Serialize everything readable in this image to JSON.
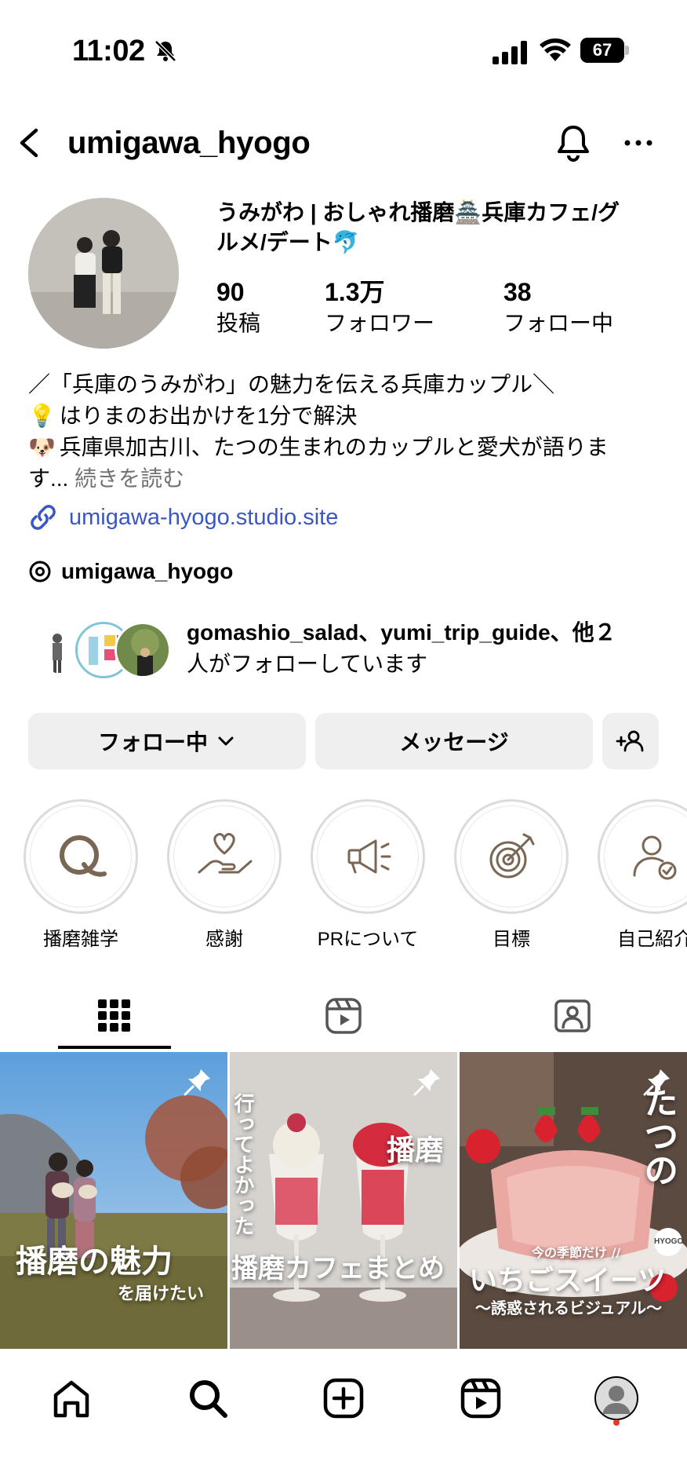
{
  "status_bar": {
    "time": "11:02",
    "battery": "67"
  },
  "header": {
    "username": "umigawa_hyogo"
  },
  "profile": {
    "display_name_line1": "うみがわ | おしゃれ播磨🏯兵庫カフェ/グ",
    "display_name_line2": "ルメ/デート🐬",
    "stats": [
      {
        "value": "90",
        "label": "投稿"
      },
      {
        "value": "1.3万",
        "label": "フォロワー"
      },
      {
        "value": "38",
        "label": "フォロー中"
      }
    ],
    "bio": {
      "line1": "／「兵庫のうみがわ」の魅力を伝える兵庫カップル＼",
      "line2_emoji": "💡",
      "line2": "はりまのお出かけを1分で解決",
      "line3_emoji": "🐶",
      "line3": "兵庫県加古川、たつの生まれのカップルと愛犬が語りま",
      "line4": "す...",
      "more": "続きを読む"
    },
    "website": "umigawa-hyogo.studio.site",
    "threads_handle": "umigawa_hyogo",
    "mutuals_line1": "gomashio_salad、yumi_trip_guide、他２",
    "mutuals_line2": "人がフォローしています"
  },
  "buttons": {
    "following": "フォロー中",
    "message": "メッセージ"
  },
  "highlights": [
    {
      "label": "播磨雑学",
      "icon": "q-letter-icon"
    },
    {
      "label": "感謝",
      "icon": "heart-hand-icon"
    },
    {
      "label": "PRについて",
      "icon": "megaphone-icon"
    },
    {
      "label": "目標",
      "icon": "target-icon"
    },
    {
      "label": "自己紹介",
      "icon": "person-check-icon"
    }
  ],
  "posts": [
    {
      "title": "播磨の魅力",
      "subtitle": "を届けたい"
    },
    {
      "vertical": "行ってよかった",
      "top": "播磨",
      "title": "播磨カフェまとめ"
    },
    {
      "top": "たつの",
      "badge": "HYOGO",
      "small": "今の季節だけ //",
      "title": "いちごスイーツ",
      "subtitle": "〜誘惑されるビジュアル〜"
    }
  ],
  "colors": {
    "link": "#3a56c4",
    "button_bg": "#efefef",
    "highlight_icon": "#7a6654"
  }
}
